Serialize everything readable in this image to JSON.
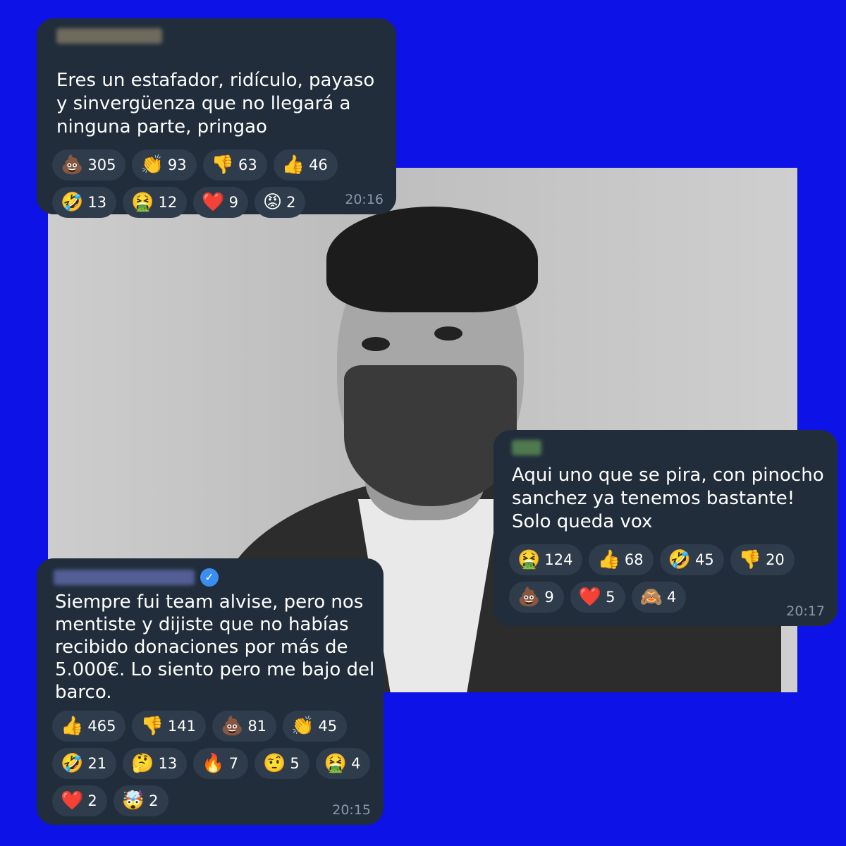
{
  "messages": [
    {
      "id": "m1",
      "text": "Eres un estafador, ridículo, payaso\ny sinvergüenza que no llegará a\nninguna parte, pringao",
      "time": "20:16",
      "reactions": [
        [
          {
            "emoji": "💩",
            "count": "305"
          },
          {
            "emoji": "👏",
            "count": "93"
          },
          {
            "emoji": "👎",
            "count": "63"
          },
          {
            "emoji": "👍",
            "count": "46"
          }
        ],
        [
          {
            "emoji": "🤣",
            "count": "13"
          },
          {
            "emoji": "🤮",
            "count": "12"
          },
          {
            "emoji": "❤️",
            "count": "9"
          },
          {
            "emoji": "😡",
            "count": "2"
          }
        ]
      ]
    },
    {
      "id": "m2",
      "text": "Aqui uno que se pira, con pinocho\nsanchez ya tenemos bastante!\nSolo queda vox",
      "time": "20:17",
      "reactions": [
        [
          {
            "emoji": "🤮",
            "count": "124"
          },
          {
            "emoji": "👍",
            "count": "68"
          },
          {
            "emoji": "🤣",
            "count": "45"
          },
          {
            "emoji": "👎",
            "count": "20"
          }
        ],
        [
          {
            "emoji": "💩",
            "count": "9"
          },
          {
            "emoji": "❤️",
            "count": "5"
          },
          {
            "emoji": "🙈",
            "count": "4"
          }
        ]
      ]
    },
    {
      "id": "m3",
      "text": "Siempre fui team alvise, pero nos\nmentiste y dijiste que no habías\nrecibido donaciones por más de\n5.000€. Lo siento pero me bajo del\nbarco.",
      "time": "20:15",
      "verified_icon": "✓",
      "reactions": [
        [
          {
            "emoji": "👍",
            "count": "465"
          },
          {
            "emoji": "👎",
            "count": "141"
          },
          {
            "emoji": "💩",
            "count": "81"
          },
          {
            "emoji": "👏",
            "count": "45"
          }
        ],
        [
          {
            "emoji": "🤣",
            "count": "21"
          },
          {
            "emoji": "🤔",
            "count": "13"
          },
          {
            "emoji": "🔥",
            "count": "7"
          },
          {
            "emoji": "🤨",
            "count": "5"
          },
          {
            "emoji": "🤮",
            "count": "4"
          }
        ],
        [
          {
            "emoji": "❤️",
            "count": "2"
          },
          {
            "emoji": "🤯",
            "count": "2"
          }
        ]
      ]
    }
  ],
  "colors": {
    "background": "#0d12e6",
    "bubble": "#212d3b",
    "reaction_pill": "#2f3c4c",
    "timestamp": "#8a98a8",
    "verified": "#3a8ef0"
  }
}
